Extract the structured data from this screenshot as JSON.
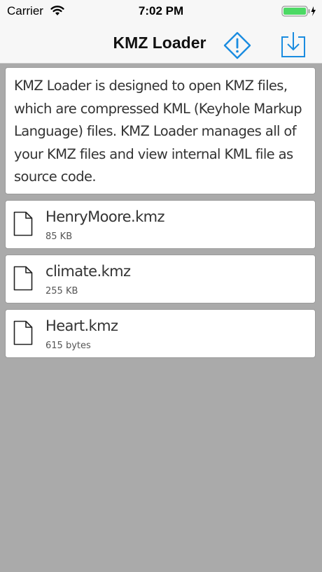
{
  "status_bar": {
    "carrier": "Carrier",
    "time": "7:02 PM"
  },
  "nav": {
    "title": "KMZ Loader"
  },
  "description": "KMZ Loader is designed to open KMZ files, which are compressed KML (Keyhole Markup Language) files. KMZ Loader manages all of your KMZ files and view internal KML file as source code.",
  "files": [
    {
      "name": "HenryMoore.kmz",
      "size": "85 KB"
    },
    {
      "name": "climate.kmz",
      "size": "255 KB"
    },
    {
      "name": "Heart.kmz",
      "size": "615 bytes"
    }
  ],
  "colors": {
    "accent": "#1a8ce0",
    "background": "#aaaaaa",
    "battery": "#4cd964"
  }
}
